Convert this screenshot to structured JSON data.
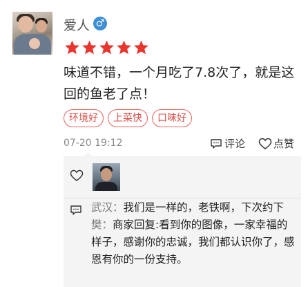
{
  "review": {
    "username": "爱人",
    "gender_symbol": "♂",
    "rating": 5,
    "text": "味道不错，一个月吃了7.8次了，就是这回的鱼老了点！",
    "tags": [
      "环境好",
      "上菜快",
      "口味好"
    ],
    "date": "07-20 19:12",
    "comment_label": "评论",
    "like_label": "点赞"
  },
  "replies": [
    {
      "name": "武汉",
      "separator": "：",
      "text": "我们是一样的，老铁啊，下次约下"
    },
    {
      "name": "樊",
      "separator": "：",
      "text": "商家回复:看到你的图像，一家幸福的样子，感谢你的忠诚，我们都认识你了，感恩有你的一份支持。"
    }
  ],
  "colors": {
    "star": "#e8352d",
    "tag_border": "#e8625a",
    "gender_badge": "#3d8fd6",
    "panel_bg": "#f4f4f4"
  }
}
